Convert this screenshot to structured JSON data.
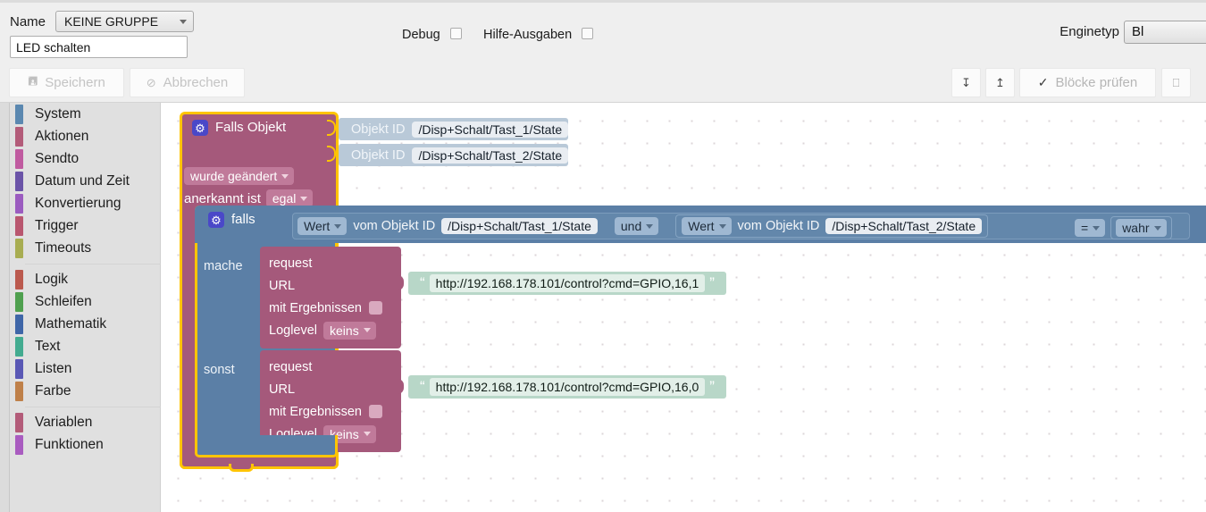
{
  "header": {
    "name_label": "Name",
    "group_select": "KEINE GRUPPE",
    "script_name_value": "LED schalten",
    "script_name_placeholder": "Name",
    "debug_label": "Debug",
    "hilfe_label": "Hilfe-Ausgaben",
    "enginetyp_label": "Enginetyp",
    "enginetyp_value": "Bl",
    "save_label": "Speichern",
    "save_icon": "save-icon",
    "cancel_label": "Abbrechen",
    "cancel_icon": "cancel-icon",
    "export_icon": "download-icon",
    "import_icon": "upload-icon",
    "check_label": "Blöcke prüfen",
    "check_icon": "checkmark-icon",
    "extra_icon": "expand-icon"
  },
  "sidebar": {
    "items": [
      {
        "label": "System",
        "color": "#5b88b0"
      },
      {
        "label": "Aktionen",
        "color": "#b35c79"
      },
      {
        "label": "Sendto",
        "color": "#c05ba0"
      },
      {
        "label": "Datum und Zeit",
        "color": "#6b54a8"
      },
      {
        "label": "Konvertierung",
        "color": "#9b5cc0"
      },
      {
        "label": "Trigger",
        "color": "#b9576f"
      },
      {
        "label": "Timeouts",
        "color": "#a8ad52"
      },
      {
        "label": "Logik",
        "color": "#bb5a4e"
      },
      {
        "label": "Schleifen",
        "color": "#4fa04f"
      },
      {
        "label": "Mathematik",
        "color": "#3f66a8"
      },
      {
        "label": "Text",
        "color": "#43ab90"
      },
      {
        "label": "Listen",
        "color": "#5a58b5"
      },
      {
        "label": "Farbe",
        "color": "#bf8049"
      },
      {
        "label": "Variablen",
        "color": "#b35c79"
      },
      {
        "label": "Funktionen",
        "color": "#a95cc0"
      }
    ],
    "separators_after": [
      6,
      12
    ]
  },
  "workspace": {
    "trigger_block": {
      "gear_icon": "gear-icon",
      "title": "Falls Objekt",
      "objid_rows": [
        {
          "label": "Objekt ID",
          "value": "/Disp+Schalt/Tast_1/State"
        },
        {
          "label": "Objekt ID",
          "value": "/Disp+Schalt/Tast_2/State"
        }
      ],
      "change_mode": "wurde geändert",
      "ack_label": "anerkannt ist",
      "ack_value": "egal"
    },
    "if_block": {
      "gear_icon": "gear-icon",
      "title": "falls",
      "condition": {
        "left": {
          "getter": "Wert",
          "label": "vom Objekt ID",
          "objid": "/Disp+Schalt/Tast_1/State"
        },
        "operator": "und",
        "right": {
          "getter": "Wert",
          "label": "vom Objekt ID",
          "objid": "/Disp+Schalt/Tast_2/State"
        },
        "comparator": "=",
        "compare_to": "wahr"
      },
      "do_label": "mache",
      "else_label": "sonst",
      "do_branch": {
        "title": "request",
        "url_label": "URL",
        "url_value": "http://192.168.178.101/control?cmd=GPIO,16,1",
        "with_results_label": "mit Ergebnissen",
        "with_results_checked": false,
        "loglevel_label": "Loglevel",
        "loglevel_value": "keins"
      },
      "else_branch": {
        "title": "request",
        "url_label": "URL",
        "url_value": "http://192.168.178.101/control?cmd=GPIO,16,0",
        "with_results_label": "mit Ergebnissen",
        "with_results_checked": false,
        "loglevel_label": "Loglevel",
        "loglevel_value": "keins"
      }
    }
  },
  "colors": {
    "selection_outline": "#ffc400",
    "trigger_block": "#a5597b",
    "if_block": "#5b7fa6",
    "text_block": "#b8d7c8",
    "objid_block": "#b9c9d8"
  }
}
